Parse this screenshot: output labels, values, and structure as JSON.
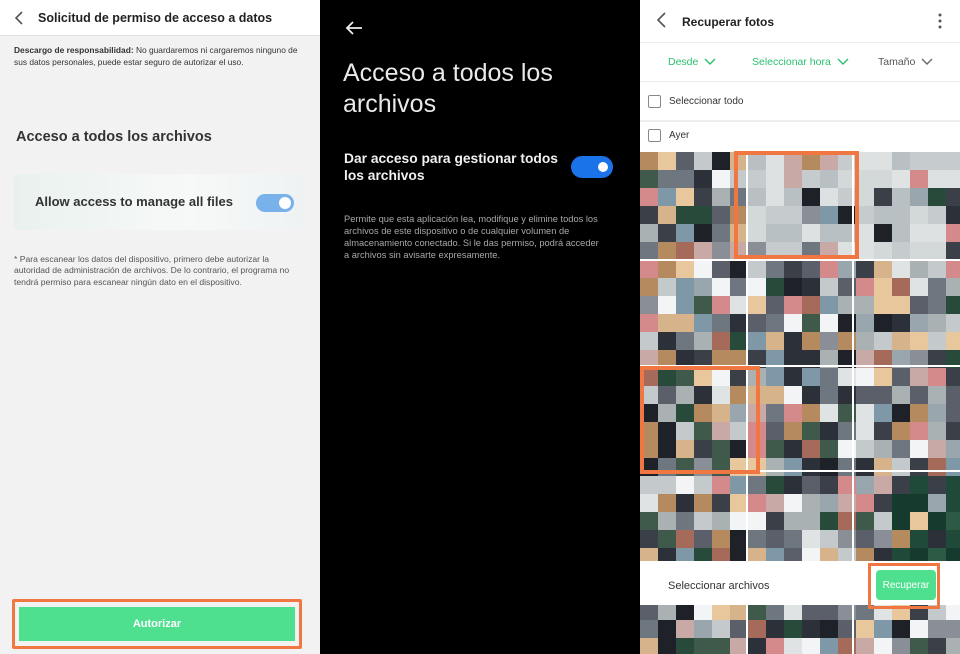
{
  "colors": {
    "accent_green": "#4fe08f",
    "filter_green": "#2bbf6f",
    "highlight_orange": "#f07742",
    "toggle_blue_light": "#79b1ea",
    "toggle_blue": "#1a73e8"
  },
  "panel1": {
    "header_title": "Solicitud de permiso de acceso a datos",
    "disclaimer_label": "Descargo de responsabilidad:",
    "disclaimer_text": " No guardaremos ni cargaremos ninguno de sus datos personales, puede estar seguro de autorizar el uso.",
    "section_title": "Acceso a todos los archivos",
    "toggle_label": "Allow access to manage all files",
    "toggle_on": true,
    "note": "* Para escanear los datos del dispositivo, primero debe autorizar la autoridad de administración de archivos. De lo contrario, el programa no tendrá permiso para escanear ningún dato en el dispositivo.",
    "authorize_button": "Autorizar"
  },
  "panel2": {
    "title": "Acceso a todos los archivos",
    "option_label": "Dar acceso para gestionar todos los archivos",
    "toggle_on": true,
    "description": "Permite que esta aplicación lea, modifique y elimine todos los archivos de este dispositivo o de cualquier volumen de almacenamiento conectado. Si le das permiso, podrá acceder a archivos sin avisarte expresamente."
  },
  "panel3": {
    "header_title": "Recuperar fotos",
    "filters": [
      "Desde",
      "Seleccionar hora",
      "Tamaño"
    ],
    "select_all": "Seleccionar todo",
    "group_label": "Ayer",
    "bottom_label": "Seleccionar archivos",
    "recover_button": "Recuperar"
  }
}
